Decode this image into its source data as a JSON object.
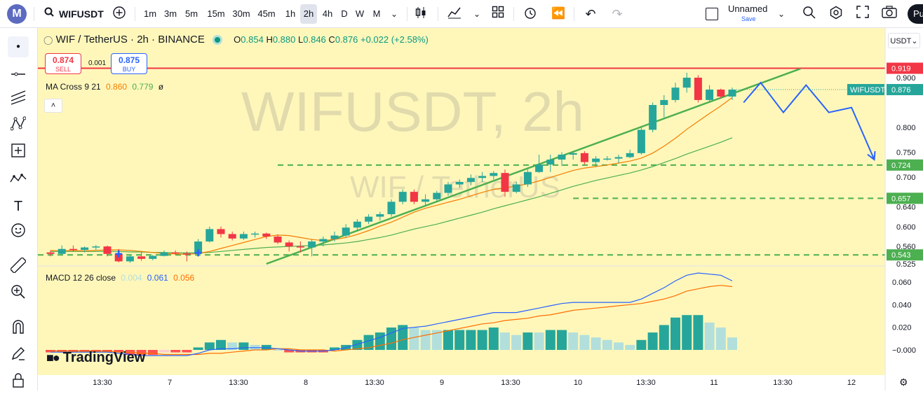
{
  "toolbar": {
    "logo_letter": "M",
    "symbol": "WIFUSDT",
    "timeframes": [
      "1m",
      "3m",
      "5m",
      "15m",
      "30m",
      "45m",
      "1h",
      "2h",
      "4h",
      "D",
      "W",
      "M"
    ],
    "active_timeframe": "2h",
    "layout_name": "Unnamed",
    "save_label": "Save",
    "publish_label": "Pu"
  },
  "header": {
    "title": "WIF / TetherUS · 2h · BINANCE",
    "open_label": "O",
    "open": "0.854",
    "high_label": "H",
    "high": "0.880",
    "low_label": "L",
    "low": "0.846",
    "close_label": "C",
    "close": "0.876",
    "change": "+0.022 (+2.58%)"
  },
  "trade": {
    "sell_price": "0.874",
    "sell_label": "SELL",
    "spread": "0.001",
    "buy_price": "0.875",
    "buy_label": "BUY"
  },
  "ma_legend": {
    "label": "MA Cross 9 21",
    "v1": "0.860",
    "v2": "0.779",
    "extra": "ø"
  },
  "macd_legend": {
    "label": "MACD 12 26 close",
    "v1": "0.004",
    "v2": "0.061",
    "v3": "0.056"
  },
  "watermark": {
    "symbol": "WIFUSDT, 2h",
    "name": "WIF / TetherUS"
  },
  "brand": "TradingView",
  "currency": "USDT",
  "colors": {
    "background": "#fff7ba",
    "up": "#26a69a",
    "down": "#f23645",
    "ma_fast": "#f57c00",
    "ma_slow": "#4caf50",
    "trendline": "#4caf50",
    "projection": "#2962ff",
    "resistance": "#f23645",
    "support": "#4caf50",
    "macd": "#2962ff",
    "signal": "#ff6d00",
    "hist_up": "#26a69a",
    "hist_up_light": "#b2dfdb"
  },
  "chart_data": {
    "type": "candlestick",
    "price_axis": {
      "ticks": [
        "0.900",
        "0.800",
        "0.750",
        "0.700",
        "0.640",
        "0.600",
        "0.560",
        "0.525"
      ],
      "tick_values": [
        0.9,
        0.8,
        0.75,
        0.7,
        0.64,
        0.6,
        0.56,
        0.525
      ]
    },
    "x_axis": {
      "ticks": [
        "13:30",
        "7",
        "13:30",
        "8",
        "13:30",
        "9",
        "13:30",
        "10",
        "13:30",
        "11",
        "13:30",
        "12"
      ]
    },
    "candles": [
      [
        0.548,
        0.552,
        0.54,
        0.545
      ],
      [
        0.545,
        0.562,
        0.543,
        0.555
      ],
      [
        0.555,
        0.562,
        0.55,
        0.553
      ],
      [
        0.553,
        0.56,
        0.548,
        0.558
      ],
      [
        0.558,
        0.563,
        0.553,
        0.56
      ],
      [
        0.56,
        0.562,
        0.54,
        0.545
      ],
      [
        0.545,
        0.555,
        0.528,
        0.53
      ],
      [
        0.53,
        0.542,
        0.527,
        0.54
      ],
      [
        0.54,
        0.55,
        0.531,
        0.535
      ],
      [
        0.535,
        0.543,
        0.532,
        0.541
      ],
      [
        0.541,
        0.552,
        0.54,
        0.548
      ],
      [
        0.548,
        0.552,
        0.543,
        0.546
      ],
      [
        0.546,
        0.55,
        0.53,
        0.545
      ],
      [
        0.545,
        0.575,
        0.542,
        0.57
      ],
      [
        0.57,
        0.6,
        0.568,
        0.595
      ],
      [
        0.595,
        0.6,
        0.578,
        0.585
      ],
      [
        0.585,
        0.59,
        0.572,
        0.576
      ],
      [
        0.576,
        0.59,
        0.573,
        0.585
      ],
      [
        0.585,
        0.59,
        0.578,
        0.586
      ],
      [
        0.586,
        0.588,
        0.575,
        0.58
      ],
      [
        0.58,
        0.584,
        0.565,
        0.568
      ],
      [
        0.568,
        0.572,
        0.55,
        0.56
      ],
      [
        0.56,
        0.57,
        0.548,
        0.558
      ],
      [
        0.558,
        0.575,
        0.54,
        0.57
      ],
      [
        0.57,
        0.58,
        0.56,
        0.575
      ],
      [
        0.575,
        0.59,
        0.57,
        0.582
      ],
      [
        0.582,
        0.605,
        0.578,
        0.598
      ],
      [
        0.598,
        0.615,
        0.59,
        0.61
      ],
      [
        0.61,
        0.625,
        0.605,
        0.62
      ],
      [
        0.62,
        0.63,
        0.612,
        0.625
      ],
      [
        0.625,
        0.655,
        0.62,
        0.65
      ],
      [
        0.65,
        0.675,
        0.645,
        0.67
      ],
      [
        0.67,
        0.675,
        0.645,
        0.65
      ],
      [
        0.65,
        0.665,
        0.642,
        0.655
      ],
      [
        0.655,
        0.672,
        0.65,
        0.668
      ],
      [
        0.668,
        0.69,
        0.662,
        0.685
      ],
      [
        0.685,
        0.695,
        0.678,
        0.69
      ],
      [
        0.69,
        0.705,
        0.683,
        0.698
      ],
      [
        0.698,
        0.71,
        0.69,
        0.702
      ],
      [
        0.702,
        0.712,
        0.695,
        0.708
      ],
      [
        0.708,
        0.715,
        0.66,
        0.67
      ],
      [
        0.67,
        0.69,
        0.667,
        0.685
      ],
      [
        0.685,
        0.715,
        0.68,
        0.71
      ],
      [
        0.71,
        0.745,
        0.708,
        0.725
      ],
      [
        0.725,
        0.745,
        0.71,
        0.735
      ],
      [
        0.735,
        0.75,
        0.722,
        0.745
      ],
      [
        0.745,
        0.752,
        0.735,
        0.748
      ],
      [
        0.748,
        0.752,
        0.725,
        0.73
      ],
      [
        0.73,
        0.742,
        0.72,
        0.737
      ],
      [
        0.737,
        0.742,
        0.733,
        0.737
      ],
      [
        0.737,
        0.745,
        0.728,
        0.74
      ],
      [
        0.74,
        0.755,
        0.738,
        0.748
      ],
      [
        0.748,
        0.8,
        0.745,
        0.795
      ],
      [
        0.795,
        0.85,
        0.79,
        0.845
      ],
      [
        0.845,
        0.865,
        0.82,
        0.855
      ],
      [
        0.855,
        0.89,
        0.85,
        0.88
      ],
      [
        0.88,
        0.91,
        0.87,
        0.9
      ],
      [
        0.9,
        0.905,
        0.85,
        0.855
      ],
      [
        0.855,
        0.885,
        0.85,
        0.876
      ],
      [
        0.876,
        0.878,
        0.858,
        0.862
      ],
      [
        0.862,
        0.88,
        0.855,
        0.876
      ]
    ],
    "ma_fast": [
      0.552,
      0.551,
      0.552,
      0.551,
      0.552,
      0.553,
      0.553,
      0.552,
      0.55,
      0.548,
      0.546,
      0.545,
      0.544,
      0.546,
      0.55,
      0.556,
      0.562,
      0.568,
      0.574,
      0.58,
      0.583,
      0.582,
      0.578,
      0.574,
      0.572,
      0.574,
      0.578,
      0.584,
      0.592,
      0.601,
      0.609,
      0.619,
      0.629,
      0.637,
      0.643,
      0.649,
      0.655,
      0.662,
      0.669,
      0.675,
      0.678,
      0.682,
      0.686,
      0.692,
      0.699,
      0.706,
      0.713,
      0.718,
      0.721,
      0.724,
      0.728,
      0.732,
      0.738,
      0.748,
      0.762,
      0.778,
      0.796,
      0.812,
      0.828,
      0.843,
      0.86
    ],
    "ma_slow": [
      0.55,
      0.55,
      0.55,
      0.55,
      0.55,
      0.55,
      0.55,
      0.549,
      0.549,
      0.548,
      0.548,
      0.547,
      0.547,
      0.547,
      0.548,
      0.55,
      0.552,
      0.554,
      0.556,
      0.558,
      0.559,
      0.56,
      0.561,
      0.562,
      0.563,
      0.565,
      0.567,
      0.57,
      0.574,
      0.578,
      0.583,
      0.589,
      0.595,
      0.6,
      0.605,
      0.611,
      0.617,
      0.623,
      0.629,
      0.636,
      0.642,
      0.648,
      0.654,
      0.66,
      0.667,
      0.674,
      0.681,
      0.687,
      0.693,
      0.698,
      0.703,
      0.708,
      0.714,
      0.721,
      0.729,
      0.737,
      0.746,
      0.754,
      0.762,
      0.77,
      0.779
    ],
    "macd": [
      -0.002,
      -0.002,
      -0.002,
      -0.002,
      -0.002,
      -0.002,
      -0.003,
      -0.004,
      -0.005,
      -0.005,
      -0.005,
      -0.005,
      -0.005,
      -0.003,
      0.0,
      0.001,
      0.001,
      0.002,
      0.002,
      0.002,
      0.001,
      0.0,
      -0.001,
      -0.001,
      -0.001,
      0.0,
      0.002,
      0.005,
      0.008,
      0.011,
      0.015,
      0.019,
      0.02,
      0.021,
      0.023,
      0.025,
      0.027,
      0.029,
      0.031,
      0.033,
      0.033,
      0.033,
      0.035,
      0.037,
      0.039,
      0.041,
      0.042,
      0.042,
      0.042,
      0.042,
      0.042,
      0.042,
      0.045,
      0.05,
      0.055,
      0.061,
      0.066,
      0.068,
      0.067,
      0.066,
      0.061
    ],
    "signal": [
      -0.001,
      -0.001,
      -0.001,
      -0.001,
      -0.001,
      -0.001,
      -0.002,
      -0.002,
      -0.003,
      -0.003,
      -0.004,
      -0.004,
      -0.004,
      -0.004,
      -0.003,
      -0.003,
      -0.002,
      -0.001,
      0.0,
      0.0,
      0.001,
      0.001,
      0.0,
      0.0,
      0.0,
      -0.001,
      0.0,
      0.001,
      0.002,
      0.004,
      0.006,
      0.009,
      0.011,
      0.013,
      0.015,
      0.017,
      0.019,
      0.021,
      0.023,
      0.024,
      0.026,
      0.027,
      0.028,
      0.03,
      0.031,
      0.033,
      0.035,
      0.036,
      0.037,
      0.038,
      0.039,
      0.04,
      0.041,
      0.043,
      0.045,
      0.048,
      0.052,
      0.054,
      0.056,
      0.057,
      0.056
    ],
    "macd_axis": {
      "ticks": [
        "0.060",
        "0.040",
        "0.020",
        "−0.000"
      ],
      "tick_values": [
        0.06,
        0.04,
        0.02,
        0.0
      ]
    },
    "lines": {
      "resistance": 0.919,
      "supports": [
        0.724,
        0.657,
        0.543
      ]
    },
    "price_labels": [
      {
        "text": "0.919",
        "value": 0.919
      },
      {
        "text": "0.876",
        "value": 0.876,
        "tag": "WIFUSDT"
      },
      {
        "text": "0.724",
        "value": 0.724
      },
      {
        "text": "0.657",
        "value": 0.657
      },
      {
        "text": "0.543",
        "value": 0.543
      }
    ],
    "projection": [
      [
        61,
        0.85
      ],
      [
        62.5,
        0.89
      ],
      [
        64.5,
        0.83
      ],
      [
        66.5,
        0.885
      ],
      [
        68.5,
        0.83
      ],
      [
        70.5,
        0.84
      ],
      [
        72.5,
        0.735
      ]
    ],
    "trendline": [
      [
        19,
        0.525
      ],
      [
        66,
        0.918
      ]
    ]
  }
}
